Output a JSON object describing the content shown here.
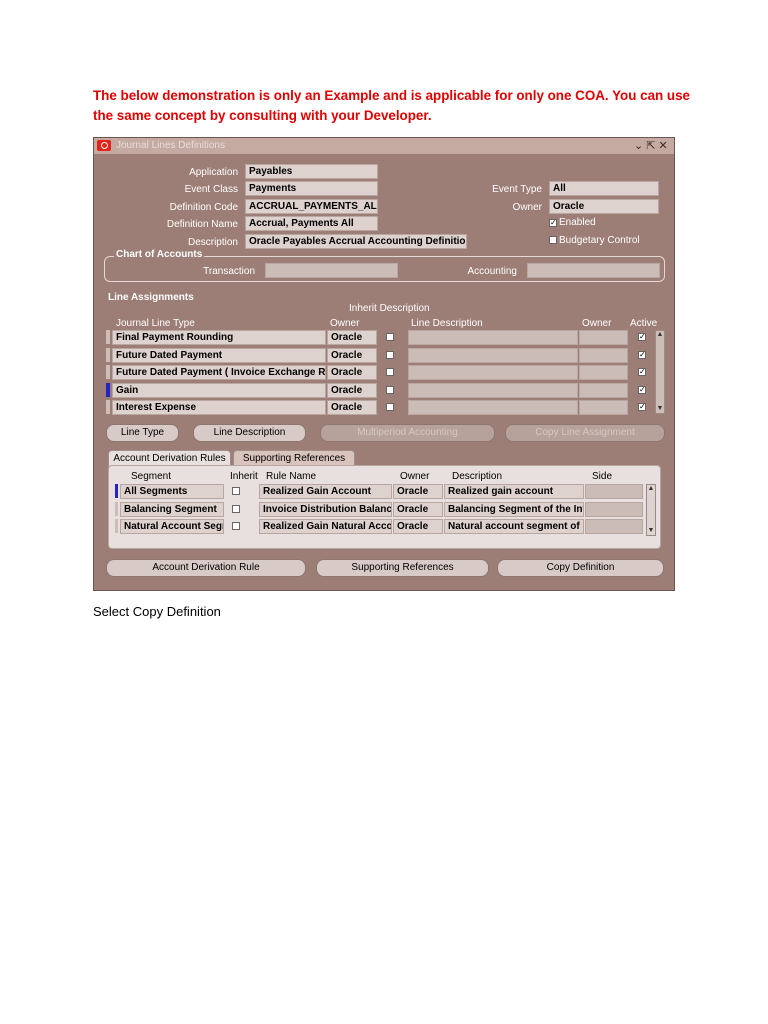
{
  "note": "The below demonstration is only an Example and is applicable for only one COA. You can use the same concept by consulting with your Developer.",
  "caption": "Select Copy Definition",
  "window": {
    "title": "Journal Lines Definitions",
    "controls": "⌄ ⇱ ✕"
  },
  "header": {
    "application_label": "Application",
    "application": "Payables",
    "event_class_label": "Event Class",
    "event_class": "Payments",
    "definition_code_label": "Definition Code",
    "definition_code": "ACCRUAL_PAYMENTS_ALL",
    "definition_name_label": "Definition Name",
    "definition_name": "Accrual, Payments All",
    "description_label": "Description",
    "description": "Oracle Payables Accrual Accounting Definition",
    "event_type_label": "Event Type",
    "event_type": "All",
    "owner_label": "Owner",
    "owner": "Oracle",
    "enabled_label": "Enabled",
    "enabled": true,
    "budgetary_label": "Budgetary Control",
    "budgetary": false
  },
  "coa": {
    "title": "Chart of Accounts",
    "transaction_label": "Transaction",
    "transaction": "",
    "accounting_label": "Accounting",
    "accounting": ""
  },
  "line_assignments": {
    "title": "Line Assignments",
    "inherit_header": "Inherit Description",
    "columns": {
      "type": "Journal Line Type",
      "owner": "Owner",
      "line_desc": "Line Description",
      "owner2": "Owner",
      "active": "Active"
    },
    "rows": [
      {
        "type": "Final Payment Rounding",
        "owner": "Oracle",
        "inherit": false,
        "active": true
      },
      {
        "type": "Future Dated Payment",
        "owner": "Oracle",
        "inherit": false,
        "active": true
      },
      {
        "type": "Future Dated Payment ( Invoice Exchange Rate )",
        "owner": "Oracle",
        "inherit": false,
        "active": true
      },
      {
        "type": "Gain",
        "owner": "Oracle",
        "inherit": false,
        "active": true
      },
      {
        "type": "Interest Expense",
        "owner": "Oracle",
        "inherit": false,
        "active": true
      }
    ],
    "buttons": {
      "line_type": "Line Type",
      "line_description": "Line Description",
      "multiperiod": "Multiperiod Accounting",
      "copy_line": "Copy Line Assignment"
    }
  },
  "tabs": {
    "account_derivation": "Account Derivation Rules",
    "supporting_refs": "Supporting References",
    "columns": {
      "segment": "Segment",
      "inherit": "Inherit",
      "rule": "Rule Name",
      "owner": "Owner",
      "description": "Description",
      "side": "Side"
    },
    "rows": [
      {
        "segment": "All Segments",
        "rule": "Realized Gain Account",
        "owner": "Oracle",
        "description": "Realized gain account"
      },
      {
        "segment": "Balancing Segment",
        "rule": "Invoice Distribution Balancing Segment",
        "owner": "Oracle",
        "description": "Balancing Segment of the Invoice"
      },
      {
        "segment": "Natural Account Segment",
        "rule": "Realized Gain Natural Account",
        "owner": "Oracle",
        "description": "Natural account segment of"
      }
    ]
  },
  "bottom_buttons": {
    "account_derivation": "Account Derivation Rule",
    "supporting_refs": "Supporting References",
    "copy_definition": "Copy Definition"
  }
}
